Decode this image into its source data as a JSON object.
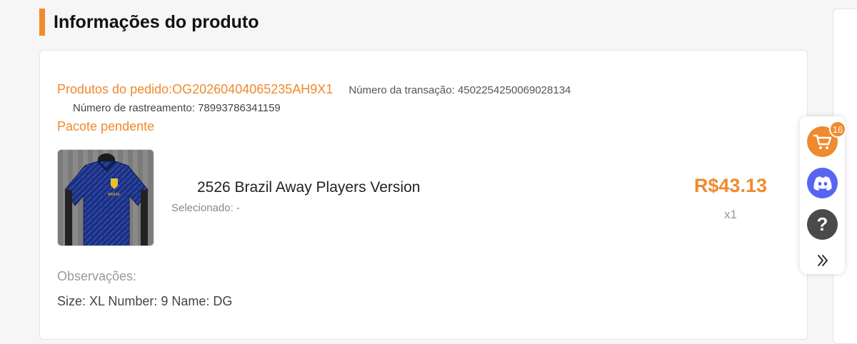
{
  "section": {
    "title": "Informações do produto"
  },
  "order": {
    "products_label": "Produtos do pedido:OG20260404065235AH9X1",
    "transaction": "Número da transação: 4502254250069028134",
    "tracking": "Número de rastreamento: 78993786341159",
    "status": "Pacote pendente"
  },
  "product": {
    "name": "2526 Brazil Away Players Version",
    "selected": "Selecionado: -",
    "price": "R$43.13",
    "quantity": "x1",
    "image_label": "BRASIL"
  },
  "notes": {
    "label": "Observações:",
    "value": "Size: XL Number: 9 Name: DG"
  },
  "toolbar": {
    "cart_count": "16",
    "help_symbol": "?",
    "icons": [
      "cart-icon",
      "discord-icon",
      "help-icon",
      "double-chevron-right-icon"
    ]
  },
  "colors": {
    "accent": "#f08a2c",
    "discord": "#5865f2",
    "help": "#4a4a4a"
  }
}
